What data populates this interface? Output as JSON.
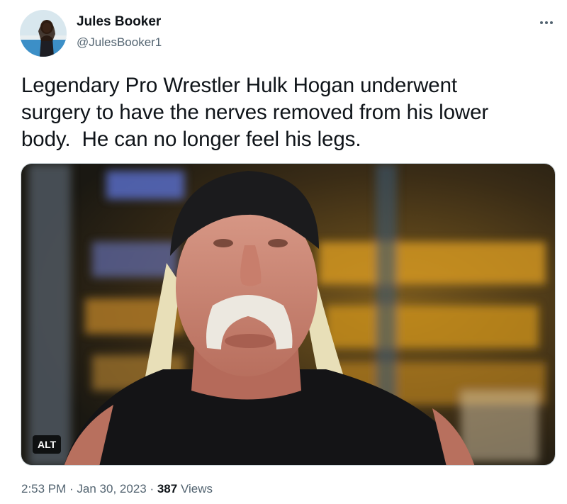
{
  "tweet": {
    "author": {
      "name": "Jules Booker",
      "handle": "@JulesBooker1",
      "avatar_icon": "avatar-photo"
    },
    "more_icon": "more-options-icon",
    "text_lines": [
      "Legendary Pro Wrestler Hulk Hogan underwent",
      "surgery to have the nerves removed from his lower",
      "body.  He can no longer feel his legs."
    ],
    "media": {
      "alt_label": "ALT"
    },
    "meta": {
      "time": "2:53 PM",
      "sep1": " · ",
      "date": "Jan 30, 2023",
      "sep2": " · ",
      "views_count": "387",
      "views_label": " Views"
    }
  },
  "colors": {
    "text": "#0f1419",
    "secondary": "#536471",
    "border": "#cfd9de"
  }
}
